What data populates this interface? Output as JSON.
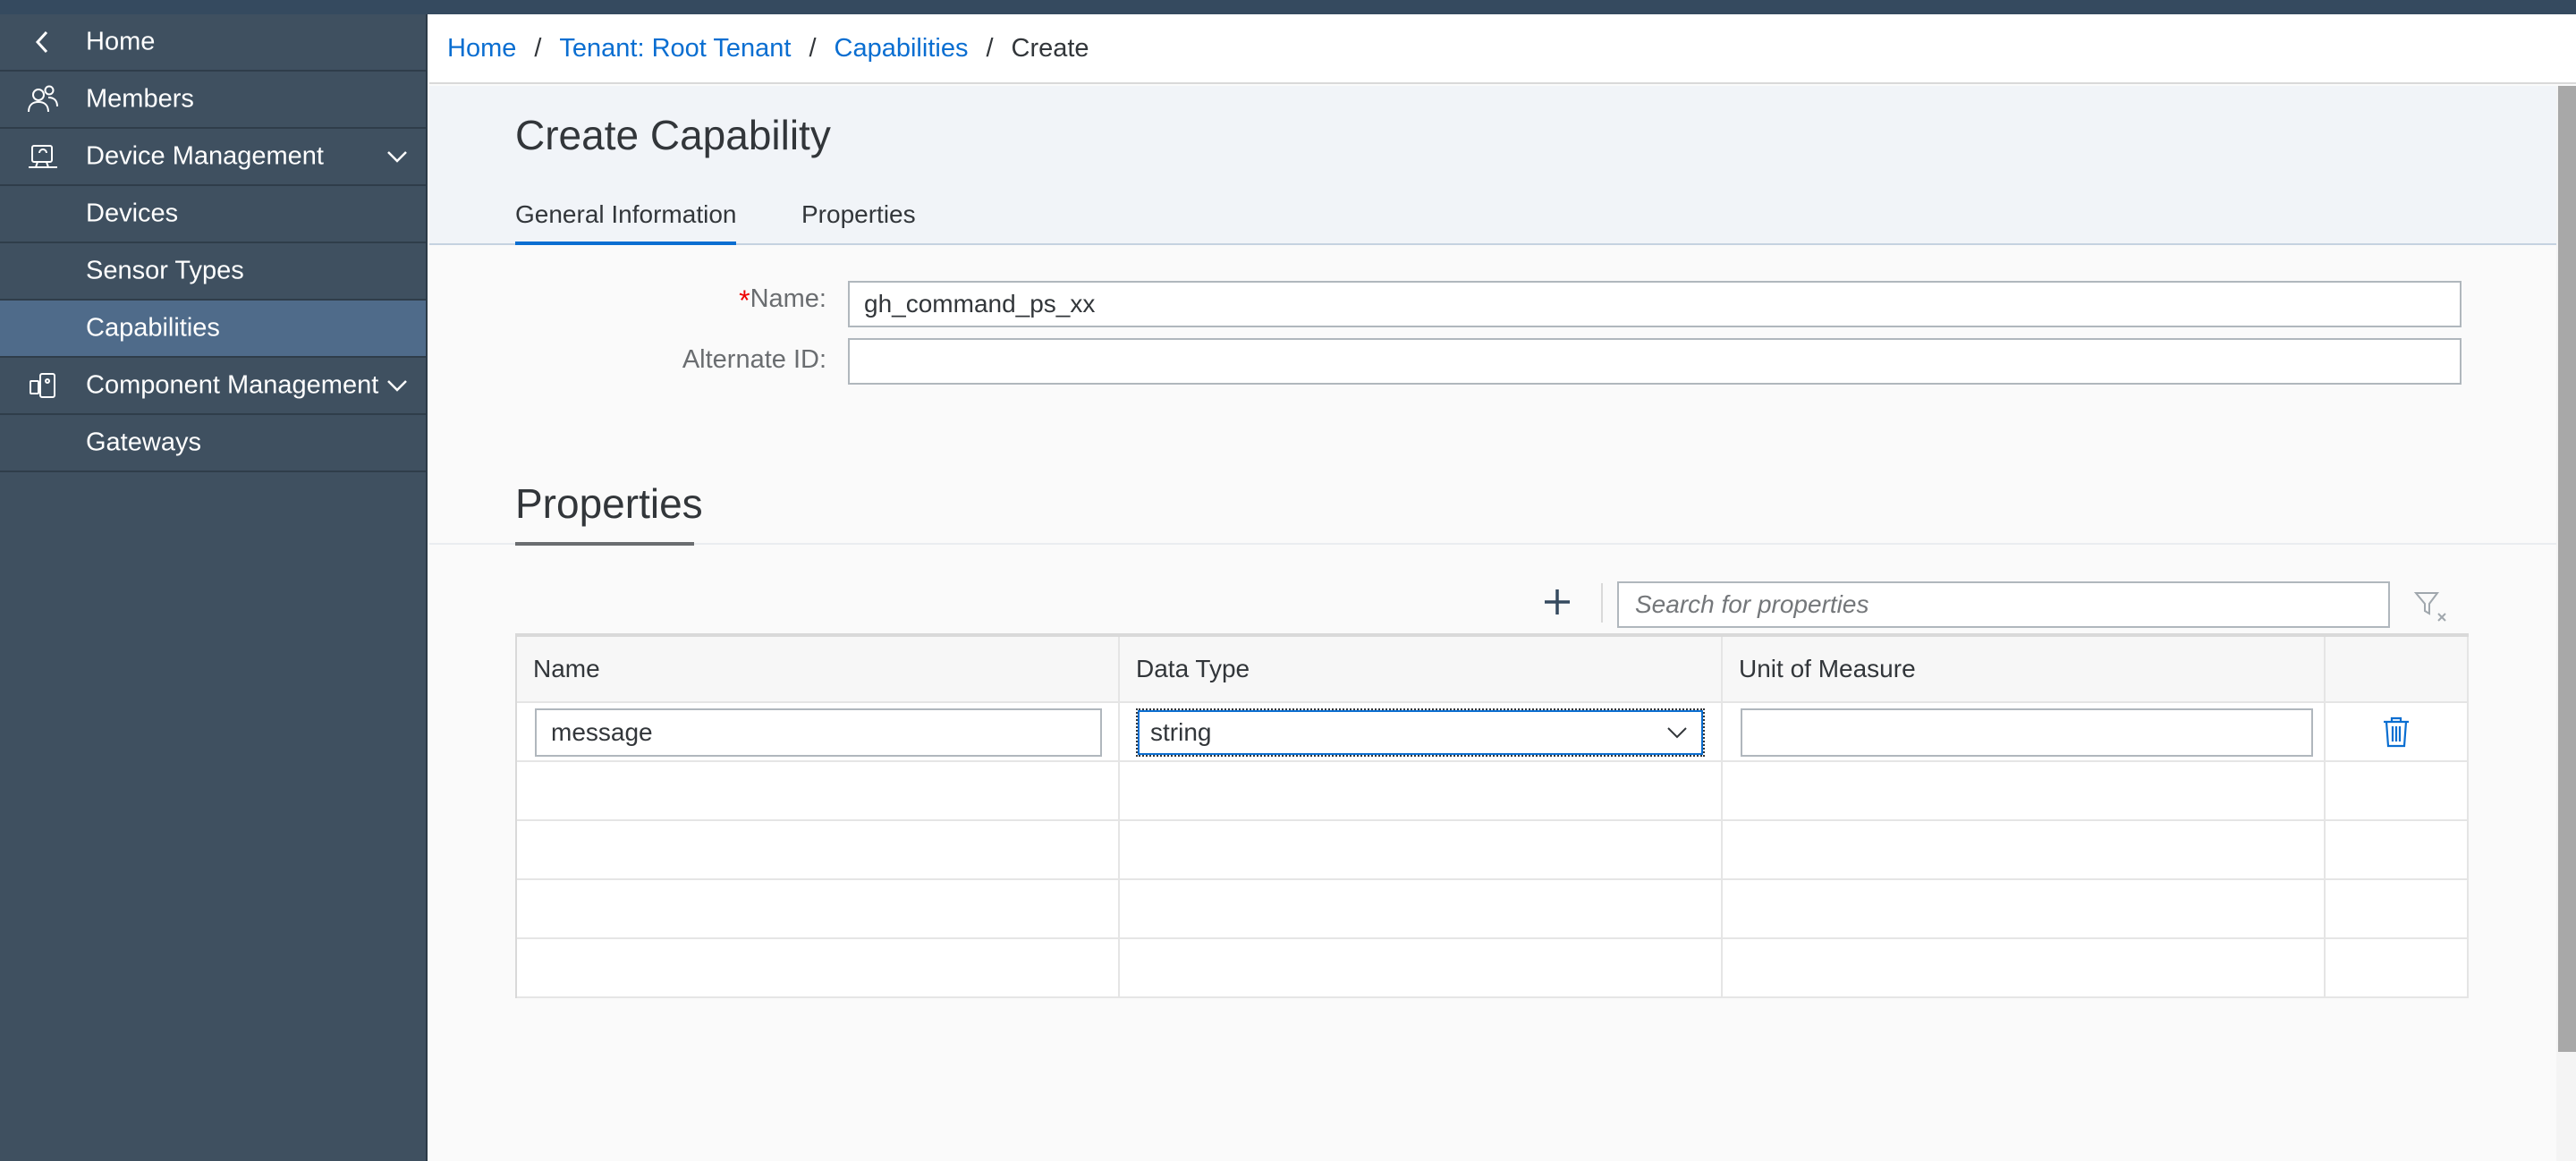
{
  "sidebar": {
    "items": [
      {
        "label": "Home",
        "icon": "chevron-left-icon"
      },
      {
        "label": "Members",
        "icon": "members-icon"
      },
      {
        "label": "Device Management",
        "icon": "device-management-icon",
        "expandable": true
      },
      {
        "label": "Devices"
      },
      {
        "label": "Sensor Types"
      },
      {
        "label": "Capabilities",
        "selected": true
      },
      {
        "label": "Component Management",
        "icon": "component-management-icon",
        "expandable": true
      },
      {
        "label": "Gateways"
      }
    ]
  },
  "breadcrumb": {
    "items": [
      "Home",
      "Tenant: Root Tenant",
      "Capabilities"
    ],
    "current": "Create",
    "separator": "/"
  },
  "header": {
    "title": "Create Capability",
    "tabs": [
      {
        "label": "General Information",
        "active": true
      },
      {
        "label": "Properties"
      }
    ]
  },
  "form": {
    "name_required_mark": "*",
    "name_label": "Name:",
    "name_value": "gh_command_ps_xx",
    "alternate_id_label": "Alternate ID:",
    "alternate_id_value": ""
  },
  "properties_section": {
    "title": "Properties",
    "search_placeholder": "Search for properties",
    "columns": [
      "Name",
      "Data Type",
      "Unit of Measure",
      ""
    ],
    "rows": [
      {
        "name": "message",
        "data_type": "string",
        "unit": ""
      }
    ],
    "empty_rows": 4
  },
  "colors": {
    "accent": "#0a6ed1",
    "sidebar_bg": "#3f5060",
    "sidebar_selected": "#4f6b8a",
    "required": "#ee0000"
  }
}
